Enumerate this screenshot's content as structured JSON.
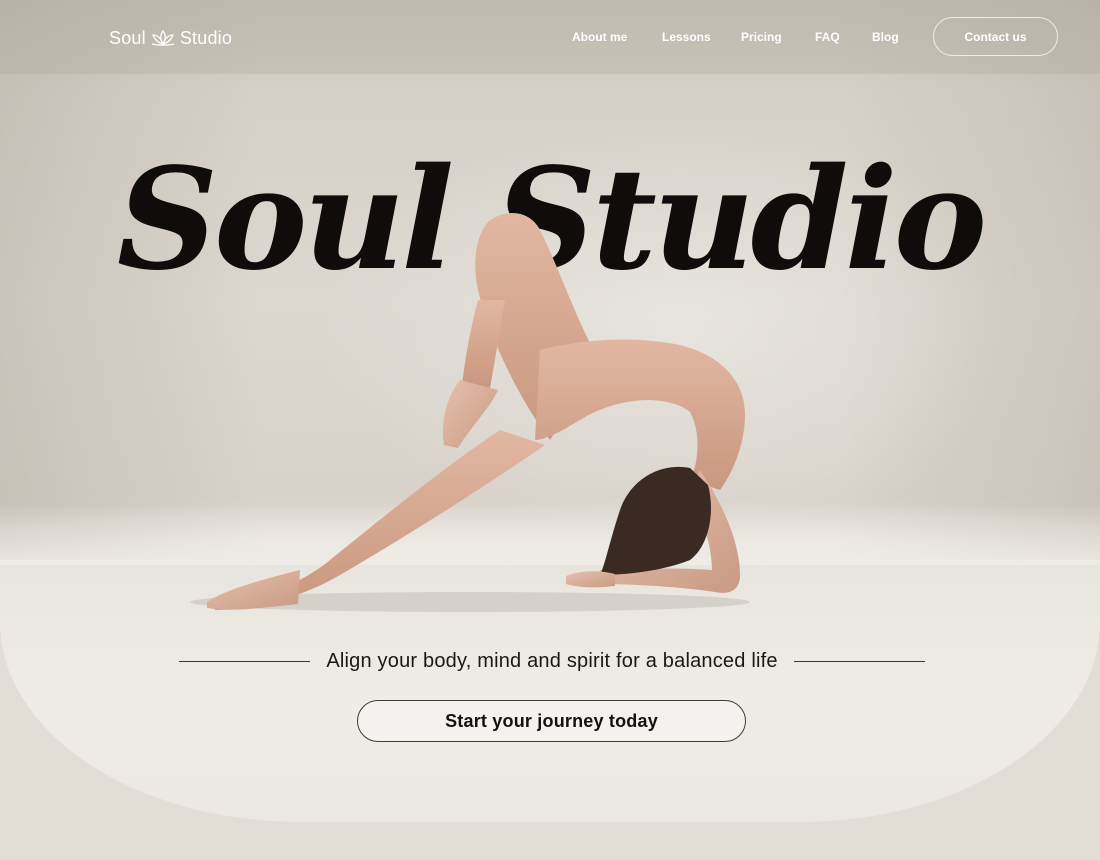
{
  "brand": {
    "name": "Soul Studio",
    "logo_icon": "lotus-icon"
  },
  "nav": {
    "links": [
      "About me",
      "Lessons",
      "Pricing",
      "FAQ",
      "Blog"
    ],
    "contact_label": "Contact us"
  },
  "hero": {
    "headline": "Soul Studio",
    "tagline": "Align your body, mind and spirit for a balanced life",
    "cta_label": "Start your journey today",
    "image": "yoga-practitioner-photo"
  },
  "colors": {
    "background": "#e2ddd5",
    "headline": "#0f0c0b",
    "nav_text": "#ffffff",
    "skin_outfit": "#dcb09a"
  }
}
